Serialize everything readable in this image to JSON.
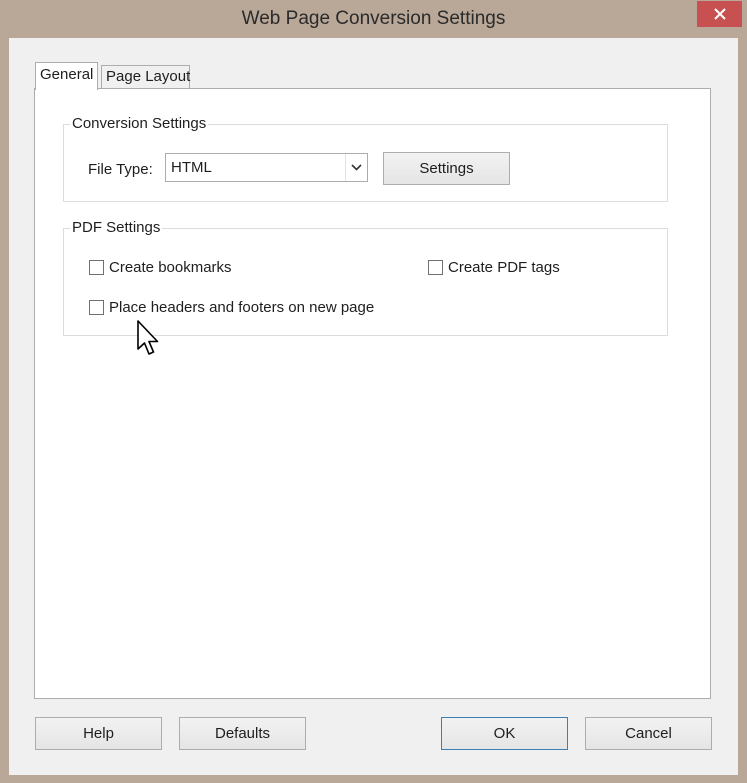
{
  "window": {
    "title": "Web Page Conversion Settings",
    "close_icon": "close-icon"
  },
  "tabs": [
    {
      "label": "General",
      "active": true
    },
    {
      "label": "Page Layout",
      "active": false
    }
  ],
  "conversion_settings": {
    "group_title": "Conversion Settings",
    "file_type_label": "File Type:",
    "file_type_value": "HTML",
    "settings_button": "Settings"
  },
  "pdf_settings": {
    "group_title": "PDF Settings",
    "checkboxes": [
      {
        "label": "Create bookmarks",
        "checked": false
      },
      {
        "label": "Create PDF tags",
        "checked": false
      },
      {
        "label": "Place headers and footers on new page",
        "checked": false
      }
    ]
  },
  "footer_buttons": {
    "help": "Help",
    "defaults": "Defaults",
    "ok": "OK",
    "cancel": "Cancel"
  },
  "colors": {
    "frame": "#b9a898",
    "close_button": "#c75050",
    "default_button_border": "#3c7fb1"
  }
}
